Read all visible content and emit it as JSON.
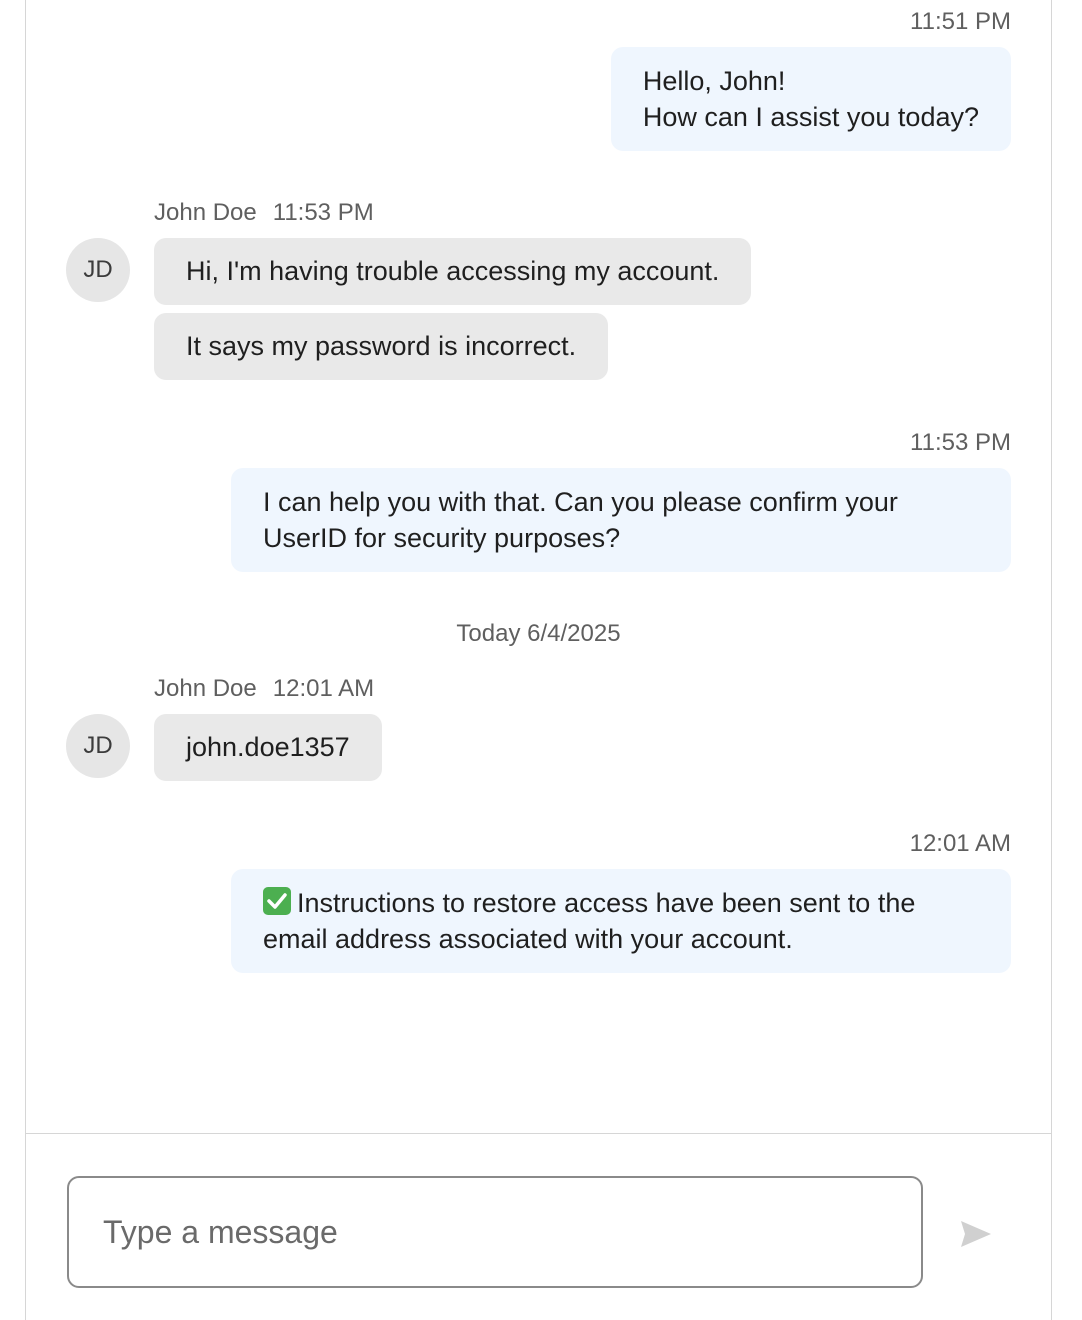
{
  "messages": [
    {
      "time": "11:51 PM",
      "text": "Hello, John!\nHow can I assist you today?"
    },
    {
      "sender": "John Doe",
      "initials": "JD",
      "time": "11:53 PM",
      "lines": [
        "Hi, I'm having trouble accessing my account.",
        "It says my password is incorrect."
      ]
    },
    {
      "time": "11:53 PM",
      "text": "I can help you with that. Can you please confirm your\nUserID for security purposes?"
    },
    {
      "date_separator": "Today 6/4/2025"
    },
    {
      "sender": "John Doe",
      "initials": "JD",
      "time": "12:01 AM",
      "lines": [
        "john.doe1357"
      ]
    },
    {
      "time": "12:01 AM",
      "icon": "check-mark-icon",
      "text": "Instructions to restore access have been sent to the\nemail address associated with your account."
    }
  ],
  "composer": {
    "placeholder": "Type a message",
    "send_icon": "send-arrow-icon"
  },
  "colors": {
    "agent_bubble": "#eff6fe",
    "user_bubble": "#e9e9e9",
    "avatar": "#e6e6e6",
    "check": "#4caf50",
    "send_icon_disabled": "#d0d0d0"
  }
}
